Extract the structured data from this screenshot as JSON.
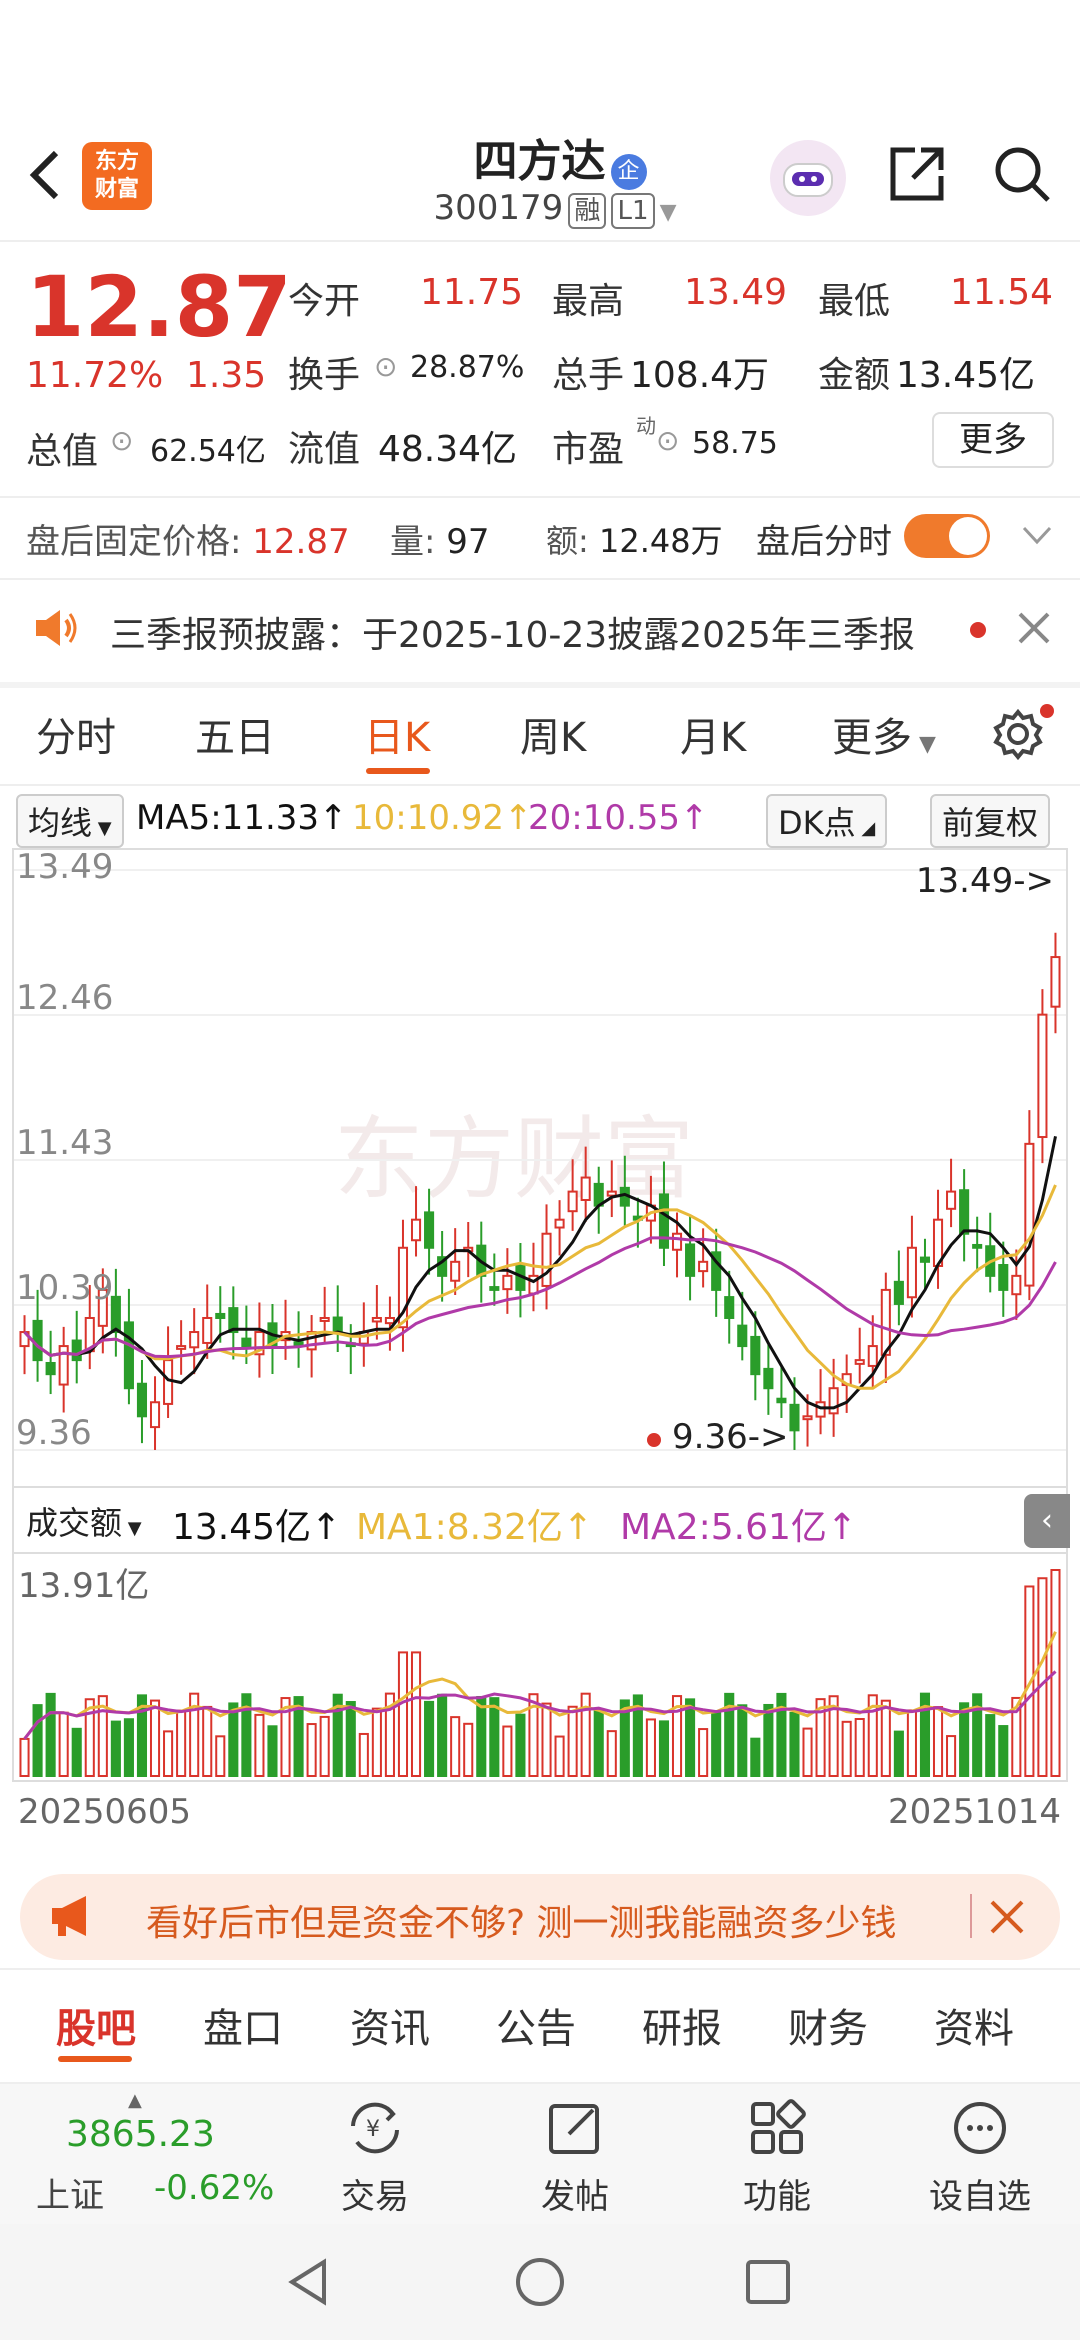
{
  "header": {
    "stock_name": "四方达",
    "enterprise_badge": "企",
    "code": "300179",
    "badge_rong": "融",
    "badge_level": "L1",
    "logo_text_line1": "东方",
    "logo_text_line2": "财富"
  },
  "quote": {
    "price": "12.87",
    "change_pct": "11.72%",
    "change_amt": "1.35",
    "open_label": "今开",
    "open_value": "11.75",
    "high_label": "最高",
    "high_value": "13.49",
    "low_label": "最低",
    "low_value": "11.54",
    "turnover_label": "换手",
    "turnover_value": "28.87%",
    "volume_label": "总手",
    "volume_value": "108.4万",
    "amount_label": "金额",
    "amount_value": "13.45亿",
    "mktcap_label": "总值",
    "mktcap_value": "62.54亿",
    "float_label": "流值",
    "float_value": "48.34亿",
    "pe_label": "市盈",
    "pe_sup": "动",
    "pe_value": "58.75",
    "more_button": "更多"
  },
  "after_hours": {
    "price_label": "盘后固定价格:",
    "price_value": "12.87",
    "vol_label": "量:",
    "vol_value": "97",
    "amt_label": "额:",
    "amt_value": "12.48万",
    "toggle_label": "盘后分时"
  },
  "notice": {
    "text": "三季报预披露：于2025-10-23披露2025年三季报"
  },
  "tabs": [
    "分时",
    "五日",
    "日K",
    "周K",
    "月K",
    "更多"
  ],
  "ma_bar": {
    "select_label": "均线",
    "ma5": "MA5:11.33↑",
    "ma10": "10:10.92↑",
    "ma20": "20:10.55↑",
    "dk_button": "DK点",
    "adjust_button": "前复权"
  },
  "kline": {
    "y_labels": [
      "13.49",
      "12.46",
      "11.43",
      "10.39",
      "9.36"
    ],
    "max_marker": "13.49->",
    "min_marker": "9.36->",
    "watermark": "东方财富"
  },
  "volume_bar": {
    "select_label": "成交额",
    "value": "13.45亿↑",
    "ma1": "MA1:8.32亿↑",
    "ma2": "MA2:5.61亿↑",
    "max_label": "13.91亿",
    "date_start": "20250605",
    "date_end": "20251014"
  },
  "ad_banner": {
    "text": "看好后市但是资金不够? 测一测我能融资多少钱"
  },
  "bottom_tabs": [
    "股吧",
    "盘口",
    "资讯",
    "公告",
    "研报",
    "财务",
    "资料"
  ],
  "toolbar": {
    "index_value": "3865.23",
    "index_name": "上证",
    "index_change": "-0.62%",
    "trade": "交易",
    "post": "发帖",
    "function": "功能",
    "watchlist": "设自选"
  },
  "colors": {
    "up": "#d9342b",
    "down": "#2a9d2a",
    "accent": "#e8581c",
    "ma5": "#111111",
    "ma10": "#e8b93a",
    "ma20": "#b03aa8"
  },
  "chart_data": {
    "type": "candlestick",
    "price_ylim": [
      9.36,
      13.49
    ],
    "x_range": [
      "20250605",
      "20251014"
    ],
    "closes": [
      10.2,
      10.0,
      9.9,
      10.1,
      10.0,
      10.3,
      10.5,
      10.2,
      9.8,
      9.6,
      9.7,
      10.0,
      10.1,
      10.2,
      10.3,
      10.3,
      10.2,
      10.1,
      10.2,
      10.1,
      10.2,
      10.1,
      10.2,
      10.3,
      10.2,
      10.1,
      10.2,
      10.3,
      10.3,
      10.8,
      11.0,
      10.8,
      10.6,
      10.7,
      10.8,
      10.6,
      10.5,
      10.6,
      10.5,
      10.6,
      10.9,
      11.0,
      11.2,
      11.3,
      11.1,
      11.2,
      11.1,
      11.0,
      11.1,
      10.8,
      10.9,
      10.6,
      10.7,
      10.5,
      10.3,
      10.1,
      9.9,
      9.8,
      9.7,
      9.5,
      9.6,
      9.7,
      9.8,
      9.9,
      10.0,
      10.1,
      10.5,
      10.4,
      10.8,
      10.7,
      11.0,
      11.2,
      10.9,
      10.8,
      10.6,
      10.5,
      10.6,
      11.54,
      12.46,
      12.87
    ],
    "volume_ymax": "13.91亿"
  }
}
